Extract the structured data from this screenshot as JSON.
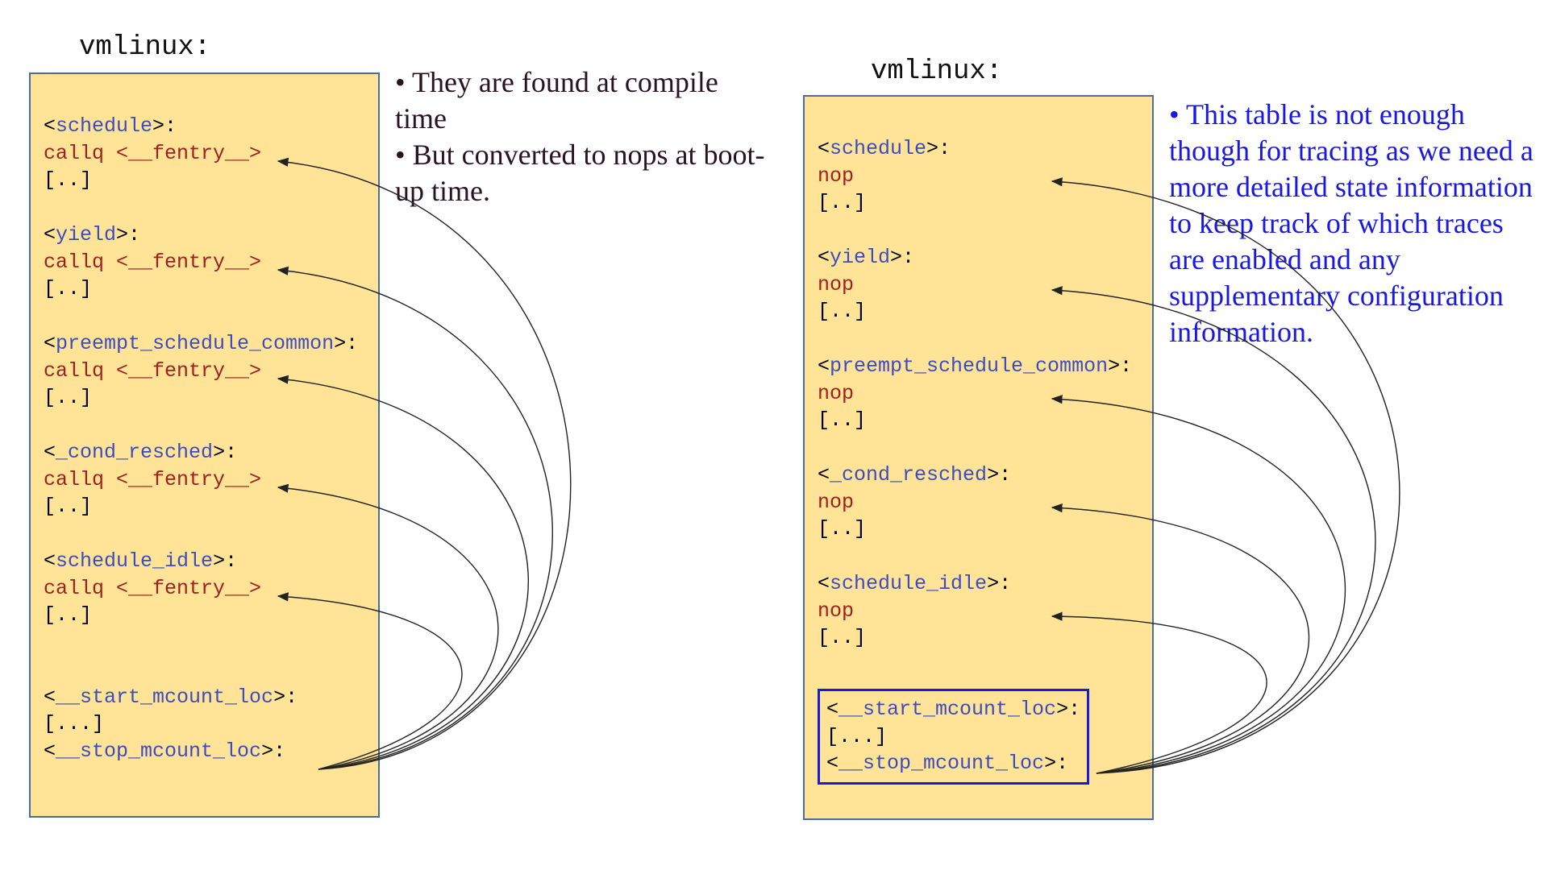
{
  "left": {
    "title": "vmlinux:",
    "functions": [
      {
        "name": "schedule",
        "instr": "callq <__fentry__>",
        "rest": "[..]"
      },
      {
        "name": "yield",
        "instr": "callq <__fentry__>",
        "rest": "[..]"
      },
      {
        "name": "preempt_schedule_common",
        "instr": "callq <__fentry__>",
        "rest": "[..]"
      },
      {
        "name": "_cond_resched",
        "instr": "callq <__fentry__>",
        "rest": "[..]"
      },
      {
        "name": "schedule_idle",
        "instr": "callq <__fentry__>",
        "rest": "[..]"
      }
    ],
    "mcount": {
      "start": "__start_mcount_loc",
      "body": "[...]",
      "stop": "__stop_mcount_loc"
    },
    "note": "• They are found at compile time\n• But converted to nops at boot-up time."
  },
  "right": {
    "title": "vmlinux:",
    "functions": [
      {
        "name": "schedule",
        "instr": "nop",
        "rest": "[..]"
      },
      {
        "name": "yield",
        "instr": "nop",
        "rest": "[..]"
      },
      {
        "name": "preempt_schedule_common",
        "instr": "nop",
        "rest": "[..]"
      },
      {
        "name": "_cond_resched",
        "instr": "nop",
        "rest": "[..]"
      },
      {
        "name": "schedule_idle",
        "instr": "nop",
        "rest": "[..]"
      }
    ],
    "mcount": {
      "start": "__start_mcount_loc",
      "body": "[...]",
      "stop": "__stop_mcount_loc"
    },
    "note": "• This table is not enough though for tracing as we need a more detailed state information to keep track of which traces are enabled and any supplementary configuration information."
  }
}
